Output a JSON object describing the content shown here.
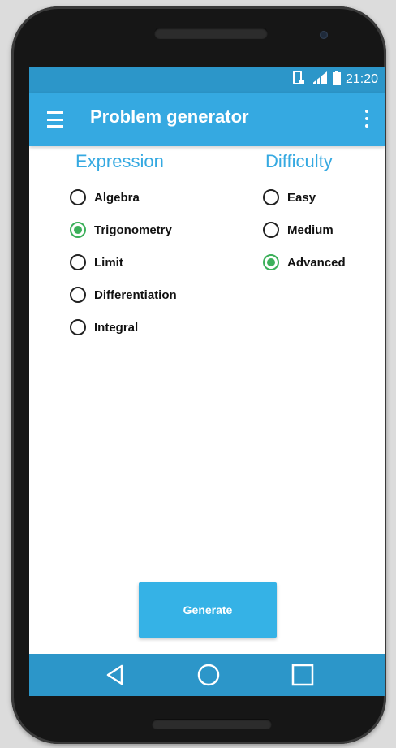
{
  "status_bar": {
    "time": "21:20",
    "icons": [
      "vibrate-icon",
      "signal-icon",
      "battery-icon"
    ]
  },
  "app_bar": {
    "title": "Problem generator",
    "icons": [
      "menu-icon",
      "overflow-menu-icon"
    ]
  },
  "expression": {
    "heading": "Expression",
    "options": [
      {
        "label": "Algebra",
        "checked": false
      },
      {
        "label": "Trigonometry",
        "checked": true
      },
      {
        "label": "Limit",
        "checked": false
      },
      {
        "label": "Differentiation",
        "checked": false
      },
      {
        "label": "Integral",
        "checked": false
      }
    ]
  },
  "difficulty": {
    "heading": "Difficulty",
    "options": [
      {
        "label": "Easy",
        "checked": false
      },
      {
        "label": "Medium",
        "checked": false
      },
      {
        "label": "Advanced",
        "checked": true
      }
    ]
  },
  "generate_button": {
    "label": "Generate"
  },
  "nav_bar": {
    "icons": [
      "back-icon",
      "home-icon",
      "recents-icon"
    ]
  },
  "colors": {
    "primary": "#35a9e1",
    "primary_dark": "#2c96c9",
    "accent": "#3cb05a"
  }
}
